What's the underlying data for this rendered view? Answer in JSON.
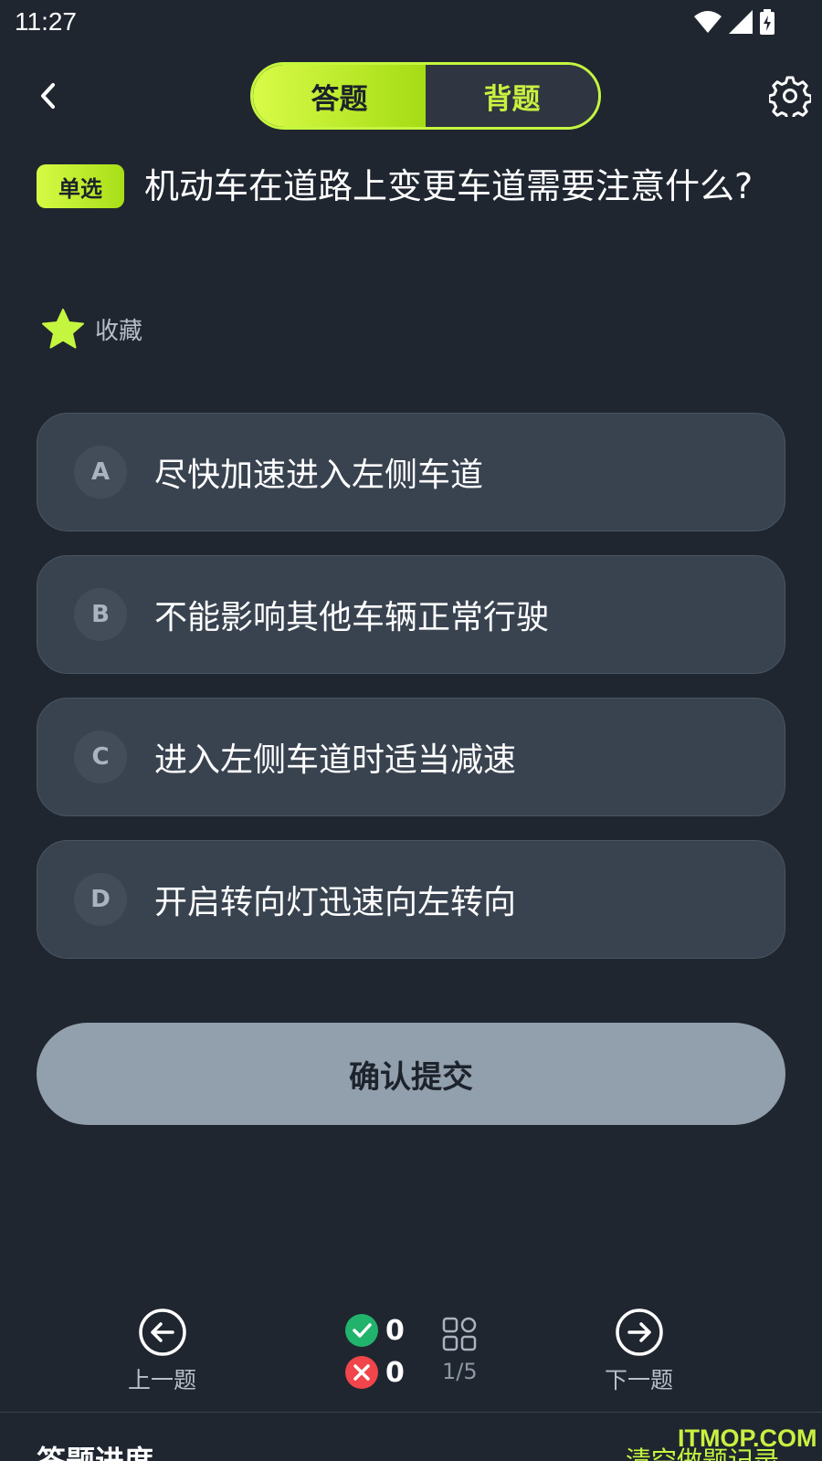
{
  "status_bar": {
    "time": "11:27"
  },
  "header": {
    "tabs": [
      {
        "label": "答题",
        "active": true
      },
      {
        "label": "背题",
        "active": false
      }
    ]
  },
  "question": {
    "type": "单选",
    "text": "机动车在道路上变更车道需要注意什么?",
    "favorite_label": "收藏"
  },
  "options": [
    {
      "letter": "A",
      "text": "尽快加速进入左侧车道"
    },
    {
      "letter": "B",
      "text": "不能影响其他车辆正常行驶"
    },
    {
      "letter": "C",
      "text": "进入左侧车道时适当减速"
    },
    {
      "letter": "D",
      "text": "开启转向灯迅速向左转向"
    }
  ],
  "submit_label": "确认提交",
  "bottom_nav": {
    "prev_label": "上一题",
    "next_label": "下一题",
    "correct_count": "0",
    "wrong_count": "0",
    "progress": "1/5"
  },
  "footer": {
    "progress_title": "答题进度",
    "clear_label": "清空做题记录",
    "watermark": "ITMOP.COM"
  },
  "colors": {
    "background": "#1f2630",
    "accent": "#c5f63f",
    "option_bg": "#394350",
    "submit_bg": "#929fac",
    "correct": "#21b36b",
    "wrong": "#f0454a"
  }
}
